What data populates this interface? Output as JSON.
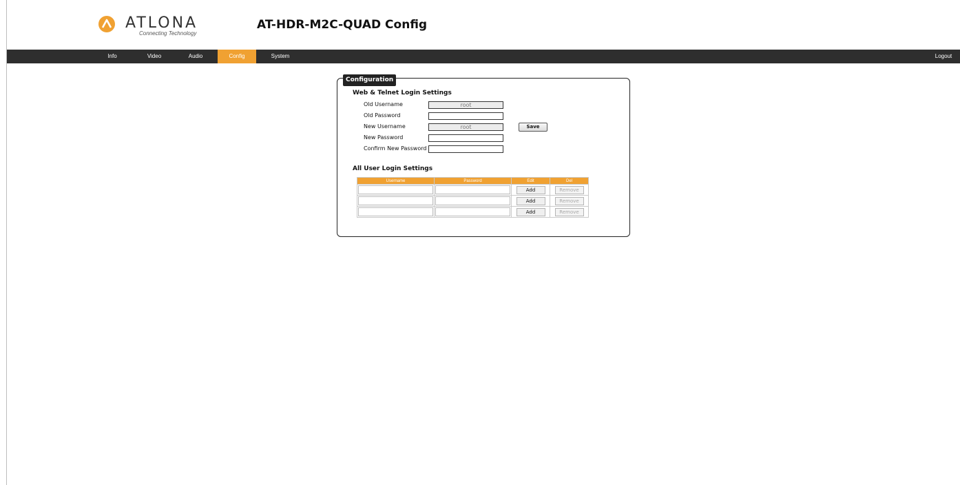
{
  "brand": {
    "logo_text": "ATLONA",
    "tagline": "Connecting Technology",
    "accent_color": "#f0a132",
    "logo_icon": "atlona-logo-icon"
  },
  "page": {
    "title": "AT-HDR-M2C-QUAD  Config"
  },
  "nav": {
    "items": [
      {
        "label": "Info"
      },
      {
        "label": "Video"
      },
      {
        "label": "Audio"
      },
      {
        "label": "Config",
        "active": true
      },
      {
        "label": "System"
      }
    ],
    "logout_label": "Logout"
  },
  "panel": {
    "legend": "Configuration",
    "web_telnet": {
      "title": "Web & Telnet Login Settings",
      "old_username_label": "Old Username",
      "old_username_value": "root",
      "old_password_label": "Old Password",
      "new_username_label": "New Username",
      "new_username_value": "root",
      "new_password_label": "New Password",
      "confirm_password_label": "Confirm New Password",
      "save_label": "Save"
    },
    "all_users": {
      "title": "All User Login Settings",
      "columns": [
        "Username",
        "Password",
        "Edit",
        "Del"
      ],
      "rows": [
        {
          "username": "",
          "password": "",
          "edit_label": "Add",
          "del_label": "Remove"
        },
        {
          "username": "",
          "password": "",
          "edit_label": "Add",
          "del_label": "Remove"
        },
        {
          "username": "",
          "password": "",
          "edit_label": "Add",
          "del_label": "Remove"
        }
      ]
    }
  }
}
